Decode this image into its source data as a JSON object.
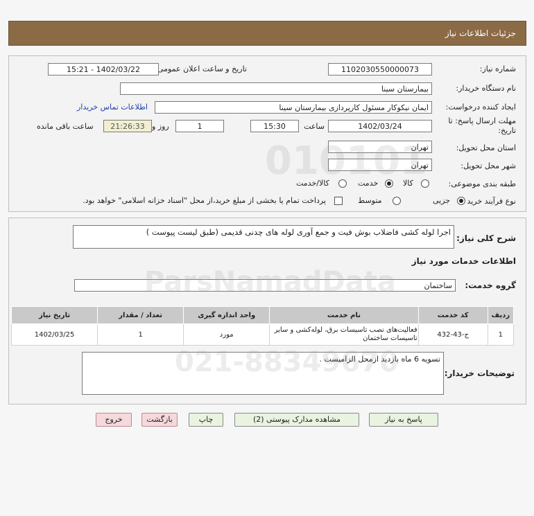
{
  "header": {
    "title": "جزئیات اطلاعات نیاز"
  },
  "form": {
    "need_number_label": "شماره نیاز:",
    "need_number": "1102030550000073",
    "announce_label": "تاریخ و ساعت اعلان عمومی:",
    "announce_value": "1402/03/22 - 15:21",
    "buyer_org_label": "نام دستگاه خریدار:",
    "buyer_org": "بیمارستان سینا",
    "requester_label": "ایجاد کننده درخواست:",
    "requester": "ایمان نیکوکار مسئول کارپردازی  بیمارستان سینا",
    "contact_link": "اطلاعات تماس خریدار",
    "deadline_label_1": "مهلت ارسال پاسخ: تا",
    "deadline_label_2": "تاریخ:",
    "deadline_date": "1402/03/24",
    "time_label": "ساعت",
    "deadline_time": "15:30",
    "days_value": "1",
    "days_label": "روز و",
    "remaining_time": "21:26:33",
    "remaining_label": "ساعت باقی مانده",
    "province_label": "استان محل تحویل:",
    "province": "تهران",
    "city_label": "شهر محل تحویل:",
    "city": "تهران",
    "category_label": "طبقه بندی موضوعی:",
    "category_options": [
      "کالا",
      "خدمت",
      "کالا/خدمت"
    ],
    "category_selected": "خدمت",
    "process_label": "نوع فرآیند خرید :",
    "process_options": [
      "جزیی",
      "متوسط"
    ],
    "process_selected": "جزیی",
    "payment_text": "پرداخت تمام یا بخشی از مبلغ خرید،از محل \"اسناد خزانه اسلامی\" خواهد بود."
  },
  "details": {
    "summary_label": "شرح کلی نیاز:",
    "summary": "اجرا لوله کشی فاضلاب بوش فیت و جمع آوری لوله های چدنی قدیمی (طبق لیست پیوست )",
    "services_heading": "اطلاعات خدمات مورد نیاز",
    "service_group_label": "گروه خدمت:",
    "service_group": "ساختمان",
    "table": {
      "headers": [
        "ردیف",
        "کد خدمت",
        "نام خدمت",
        "واحد اندازه گیری",
        "تعداد / مقدار",
        "تاریخ نیاز"
      ],
      "rows": [
        [
          "1",
          "ج-43-432",
          "فعالیت‌های نصب تاسیسات برق، لوله‌کشی و سایر تاسیسات ساختمان",
          "مورد",
          "1",
          "1402/03/25"
        ]
      ]
    },
    "buyer_notes_label": "توضیحات خریدار:",
    "buyer_notes": "تسویه 6 ماه بازدید ازمحل الزامیست ."
  },
  "buttons": {
    "reply": "پاسخ به نیاز",
    "attachments": "مشاهده مدارک پیوستی (2)",
    "print": "چاپ",
    "back": "بازگشت",
    "exit": "خروج"
  },
  "watermark": {
    "digits": "010101",
    "brand": "ParsNamadData",
    "phone": "021-88349670"
  },
  "colors": {
    "header_bg": "#8b6a46",
    "button_green": "#e8f3e0",
    "button_pink": "#f5d9dd",
    "link": "#1a3fa8"
  }
}
